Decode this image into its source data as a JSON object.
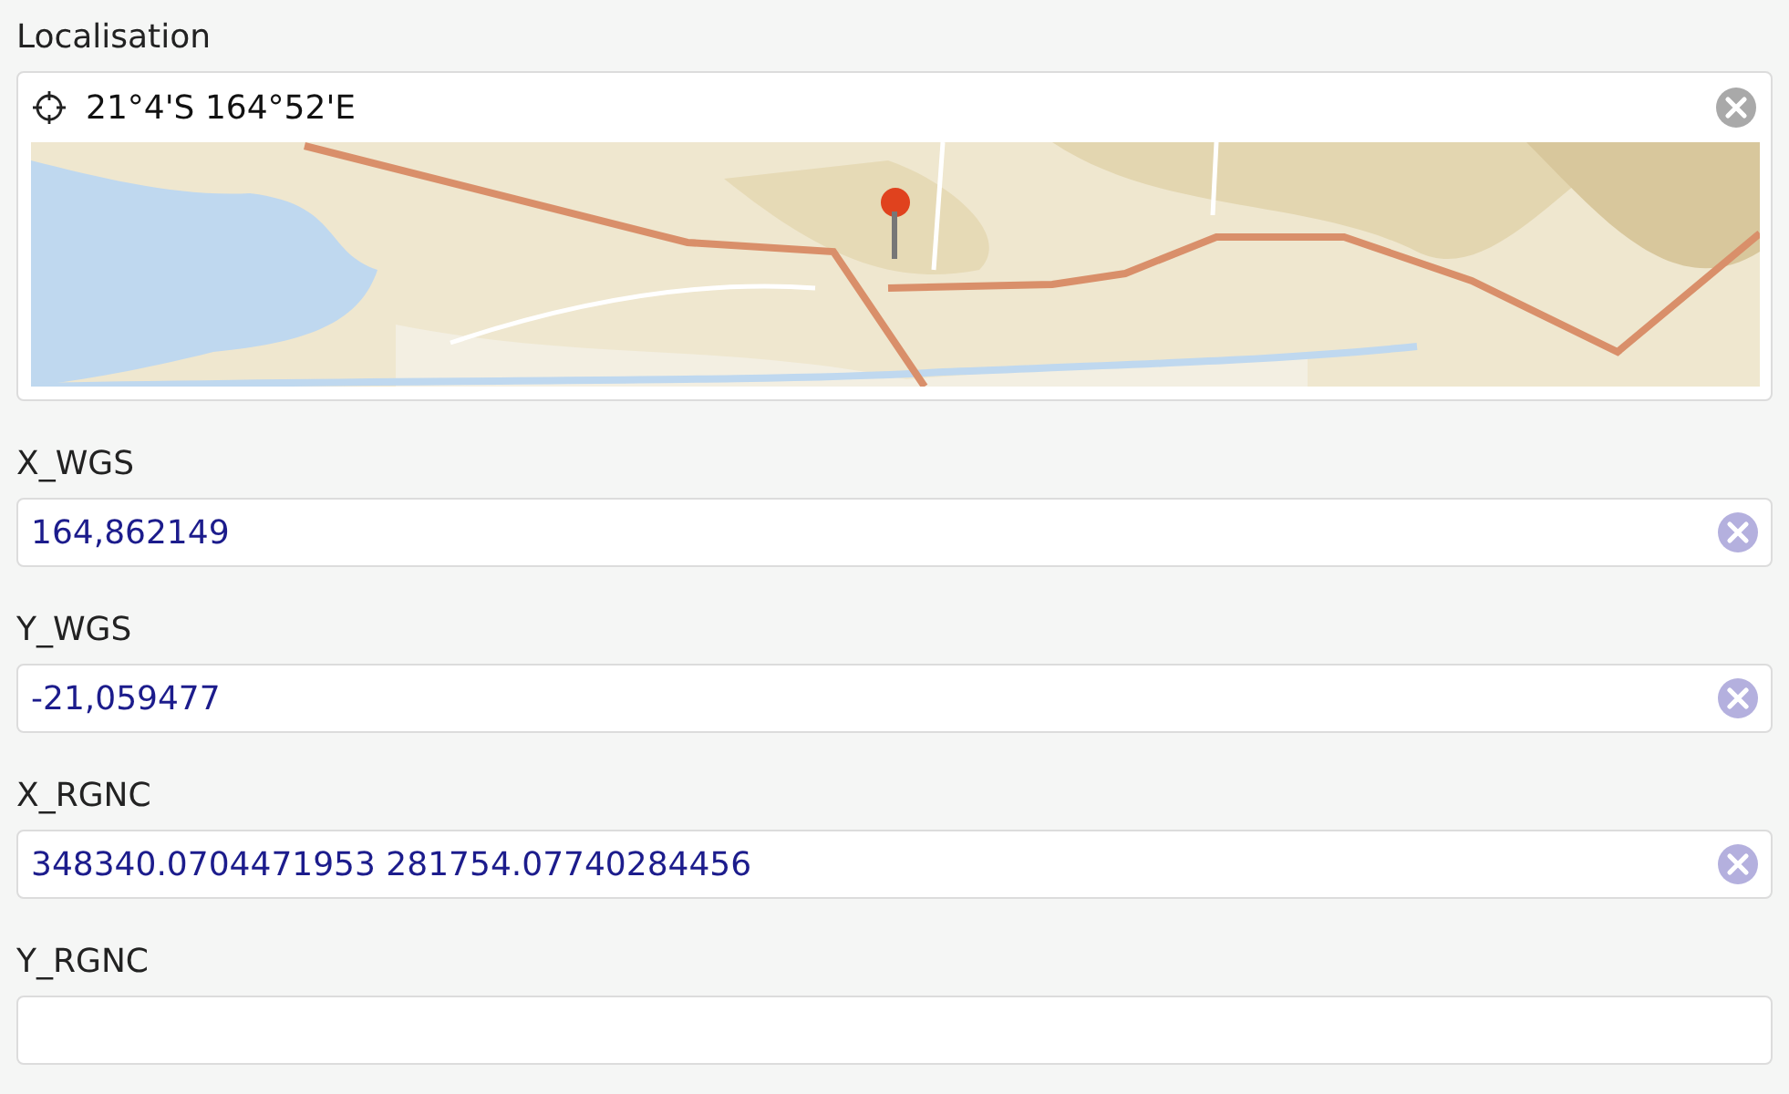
{
  "location": {
    "label": "Localisation",
    "value": "21°4'S 164°52'E"
  },
  "fields": [
    {
      "label": "X_WGS",
      "value": "164,862149"
    },
    {
      "label": "Y_WGS",
      "value": "-21,059477"
    },
    {
      "label": "X_RGNC",
      "value": "348340.0704471953 281754.07740284456"
    },
    {
      "label": "Y_RGNC"
    }
  ]
}
